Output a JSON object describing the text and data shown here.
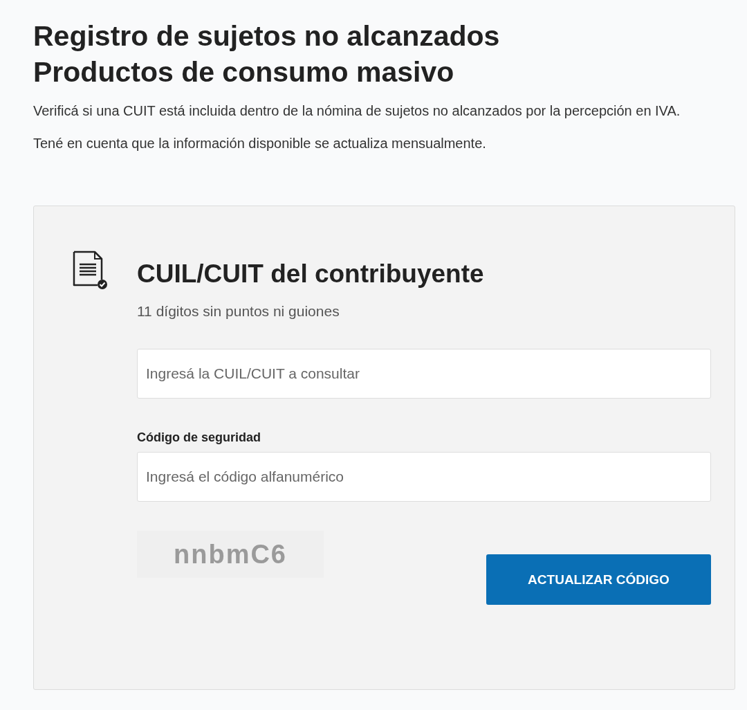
{
  "page": {
    "title_lines": [
      "Registro de sujetos no alcanzados",
      "Productos de consumo masivo"
    ],
    "paragraphs": [
      "Verificá si una CUIT está incluida dentro de la nómina de sujetos no alcanzados por la percepción en IVA.",
      "Tené en cuenta que la información disponible se actualiza mensualmente."
    ]
  },
  "form": {
    "heading": "CUIL/CUIT del contribuyente",
    "hint": "11 dígitos sin puntos ni guiones",
    "cuit_field": {
      "placeholder": "Ingresá la CUIL/CUIT a consultar"
    },
    "security": {
      "label": "Código de seguridad",
      "placeholder": "Ingresá el código alfanumérico"
    },
    "captcha": {
      "text": "nnbmC6"
    },
    "refresh_button": "ACTUALIZAR CÓDIGO"
  }
}
